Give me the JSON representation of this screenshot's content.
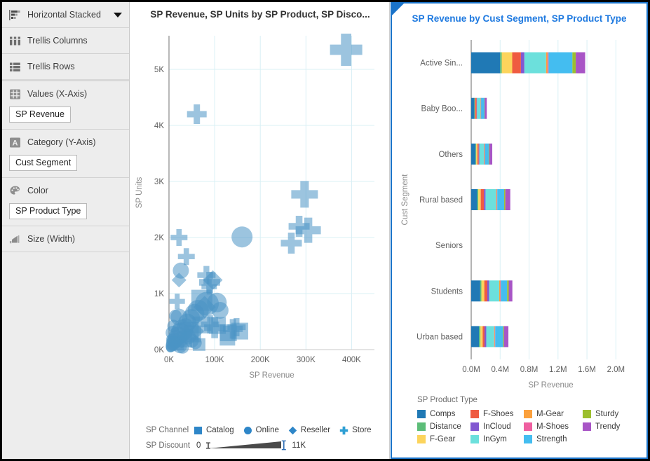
{
  "sidebar": {
    "chart_type": {
      "label": "Horizontal Stacked",
      "icon": "horizontal-stacked-icon",
      "caret": "chevron-down-icon"
    },
    "shelves": [
      {
        "label": "Trellis Columns",
        "icon": "trellis-columns-icon",
        "pill": null
      },
      {
        "label": "Trellis Rows",
        "icon": "trellis-rows-icon",
        "pill": null
      },
      {
        "label": "Values (X-Axis)",
        "icon": "values-measure-icon",
        "pill": "SP Revenue"
      },
      {
        "label": "Category (Y-Axis)",
        "icon": "attribute-icon",
        "pill": "Cust Segment"
      },
      {
        "label": "Color",
        "icon": "palette-icon",
        "pill": "SP Product Type"
      },
      {
        "label": "Size (Width)",
        "icon": "size-width-icon",
        "pill": null
      }
    ]
  },
  "scatter": {
    "title": "SP Revenue, SP Units by SP Product, SP Disco...",
    "legends": {
      "channel": {
        "label": "SP Channel",
        "items": [
          {
            "name": "Catalog",
            "shape": "square",
            "color": "#2e86c8"
          },
          {
            "name": "Online",
            "shape": "circle",
            "color": "#2e86c8"
          },
          {
            "name": "Reseller",
            "shape": "diamond",
            "color": "#2e86c8"
          },
          {
            "name": "Store",
            "shape": "plus",
            "color": "#2e9fd4"
          }
        ]
      },
      "discount": {
        "label": "SP Discount",
        "min": "0",
        "max": "11K"
      }
    }
  },
  "bars": {
    "title": "SP Revenue by Cust Segment, SP Product Type",
    "legend_title": "SP Product Type",
    "legend_order": [
      "Comps",
      "Distance",
      "F-Gear",
      "F-Shoes",
      "InCloud",
      "InGym",
      "M-Gear",
      "M-Shoes",
      "Strength",
      "Sturdy",
      "Trendy"
    ]
  },
  "colors": {
    "Comps": "#2079b5",
    "Distance": "#5cbd78",
    "F-Gear": "#fcd45c",
    "F-Shoes": "#ef5b41",
    "InCloud": "#8258d1",
    "InGym": "#6ce0dc",
    "M-Gear": "#fba03c",
    "M-Shoes": "#ef5fa0",
    "Strength": "#44bdf0",
    "Sturdy": "#9cbf2e",
    "Trendy": "#a855c6",
    "accent": "#1a73c9",
    "scatter_mark": "#4a93c4",
    "grid": "#d9f0f5"
  },
  "chart_data": [
    {
      "type": "scatter",
      "title": "SP Revenue, SP Units by SP Product, SP Disco...",
      "xlabel": "SP Revenue",
      "ylabel": "SP Units",
      "xlim": [
        0,
        450000
      ],
      "ylim": [
        0,
        5600
      ],
      "xticks": [
        "0K",
        "100K",
        "200K",
        "300K",
        "400K"
      ],
      "xtick_values": [
        0,
        100000,
        200000,
        300000,
        400000
      ],
      "yticks": [
        "0K",
        "1K",
        "2K",
        "3K",
        "4K",
        "5K"
      ],
      "ytick_values": [
        0,
        1000,
        2000,
        3000,
        4000,
        5000
      ],
      "grid": true,
      "legend_position": "bottom",
      "shape_encoding": "SP Channel",
      "size_encoding": "SP Discount",
      "points": [
        {
          "x": 388000,
          "y": 5350,
          "shape": "plus",
          "size": 46
        },
        {
          "x": 61000,
          "y": 4200,
          "shape": "plus",
          "size": 28
        },
        {
          "x": 160000,
          "y": 2010,
          "shape": "circle",
          "size": 30
        },
        {
          "x": 297000,
          "y": 2770,
          "shape": "plus",
          "size": 38
        },
        {
          "x": 285000,
          "y": 2200,
          "shape": "plus",
          "size": 30
        },
        {
          "x": 305000,
          "y": 2130,
          "shape": "plus",
          "size": 36
        },
        {
          "x": 268000,
          "y": 1900,
          "shape": "plus",
          "size": 30
        },
        {
          "x": 22000,
          "y": 2000,
          "shape": "plus",
          "size": 24
        },
        {
          "x": 38000,
          "y": 1660,
          "shape": "plus",
          "size": 24
        },
        {
          "x": 26000,
          "y": 1410,
          "shape": "circle",
          "size": 23
        },
        {
          "x": 22000,
          "y": 1240,
          "shape": "diamond",
          "size": 21
        },
        {
          "x": 82000,
          "y": 1330,
          "shape": "plus",
          "size": 26
        },
        {
          "x": 96000,
          "y": 1240,
          "shape": "diamond",
          "size": 28
        },
        {
          "x": 89000,
          "y": 1200,
          "shape": "plus",
          "size": 30
        },
        {
          "x": 88000,
          "y": 1120,
          "shape": "plus",
          "size": 22
        },
        {
          "x": 18000,
          "y": 860,
          "shape": "plus",
          "size": 22
        },
        {
          "x": 14000,
          "y": 600,
          "shape": "circle",
          "size": 18
        },
        {
          "x": 22000,
          "y": 580,
          "shape": "circle",
          "size": 24
        },
        {
          "x": 72000,
          "y": 880,
          "shape": "square",
          "size": 30
        },
        {
          "x": 83000,
          "y": 820,
          "shape": "circle",
          "size": 34
        },
        {
          "x": 78000,
          "y": 760,
          "shape": "diamond",
          "size": 32
        },
        {
          "x": 105000,
          "y": 840,
          "shape": "circle",
          "size": 28
        },
        {
          "x": 112000,
          "y": 700,
          "shape": "circle",
          "size": 24
        },
        {
          "x": 64000,
          "y": 700,
          "shape": "circle",
          "size": 30
        },
        {
          "x": 56000,
          "y": 640,
          "shape": "circle",
          "size": 28
        },
        {
          "x": 48000,
          "y": 560,
          "shape": "circle",
          "size": 26
        },
        {
          "x": 40000,
          "y": 480,
          "shape": "circle",
          "size": 26
        },
        {
          "x": 36000,
          "y": 410,
          "shape": "circle",
          "size": 24
        },
        {
          "x": 30000,
          "y": 350,
          "shape": "circle",
          "size": 30
        },
        {
          "x": 25000,
          "y": 300,
          "shape": "circle",
          "size": 28
        },
        {
          "x": 20000,
          "y": 250,
          "shape": "circle",
          "size": 26
        },
        {
          "x": 16000,
          "y": 200,
          "shape": "circle",
          "size": 24
        },
        {
          "x": 12000,
          "y": 160,
          "shape": "circle",
          "size": 22
        },
        {
          "x": 9000,
          "y": 120,
          "shape": "circle",
          "size": 20
        },
        {
          "x": 7000,
          "y": 90,
          "shape": "circle",
          "size": 18
        },
        {
          "x": 5000,
          "y": 60,
          "shape": "circle",
          "size": 16
        },
        {
          "x": 4000,
          "y": 40,
          "shape": "circle",
          "size": 14
        },
        {
          "x": 3000,
          "y": 25,
          "shape": "circle",
          "size": 12
        },
        {
          "x": 45000,
          "y": 330,
          "shape": "square",
          "size": 26
        },
        {
          "x": 52000,
          "y": 280,
          "shape": "square",
          "size": 24
        },
        {
          "x": 60000,
          "y": 330,
          "shape": "diamond",
          "size": 22
        },
        {
          "x": 70000,
          "y": 440,
          "shape": "square",
          "size": 24
        },
        {
          "x": 90000,
          "y": 450,
          "shape": "plus",
          "size": 26
        },
        {
          "x": 100000,
          "y": 390,
          "shape": "plus",
          "size": 30
        },
        {
          "x": 106000,
          "y": 430,
          "shape": "square",
          "size": 24
        },
        {
          "x": 130000,
          "y": 300,
          "shape": "square",
          "size": 24
        },
        {
          "x": 140000,
          "y": 370,
          "shape": "plus",
          "size": 28
        },
        {
          "x": 148000,
          "y": 400,
          "shape": "plus",
          "size": 26
        },
        {
          "x": 155000,
          "y": 330,
          "shape": "square",
          "size": 24
        },
        {
          "x": 128000,
          "y": 210,
          "shape": "square",
          "size": 22
        },
        {
          "x": 34000,
          "y": 180,
          "shape": "square",
          "size": 22
        },
        {
          "x": 28000,
          "y": 140,
          "shape": "diamond",
          "size": 20
        },
        {
          "x": 18000,
          "y": 110,
          "shape": "square",
          "size": 20
        },
        {
          "x": 13000,
          "y": 75,
          "shape": "diamond",
          "size": 18
        },
        {
          "x": 42000,
          "y": 230,
          "shape": "circle",
          "size": 22
        },
        {
          "x": 50000,
          "y": 160,
          "shape": "circle",
          "size": 20
        },
        {
          "x": 58000,
          "y": 120,
          "shape": "circle",
          "size": 18
        },
        {
          "x": 66000,
          "y": 90,
          "shape": "square",
          "size": 18
        },
        {
          "x": 24000,
          "y": 60,
          "shape": "circle",
          "size": 20
        },
        {
          "x": 30000,
          "y": 40,
          "shape": "circle",
          "size": 18
        },
        {
          "x": 8000,
          "y": 300,
          "shape": "circle",
          "size": 20
        },
        {
          "x": 10000,
          "y": 420,
          "shape": "circle",
          "size": 18
        },
        {
          "x": 6000,
          "y": 180,
          "shape": "circle",
          "size": 16
        }
      ]
    },
    {
      "type": "bar",
      "orientation": "horizontal",
      "stacked": true,
      "title": "SP Revenue by Cust Segment, SP Product Type",
      "xlabel": "SP Revenue",
      "ylabel": "Cust Segment",
      "xlim": [
        0,
        2200000
      ],
      "xticks": [
        "0.0M",
        "0.4M",
        "0.8M",
        "1.2M",
        "1.6M",
        "2.0M"
      ],
      "xtick_values": [
        0,
        400000,
        800000,
        1200000,
        1600000,
        2000000
      ],
      "categories": [
        "Active Sin...",
        "Baby Boo...",
        "Others",
        "Rural based",
        "Seniors",
        "Students",
        "Urban based"
      ],
      "grid": true,
      "legend_position": "bottom",
      "series": [
        {
          "name": "Comps",
          "values": [
            400000,
            44000,
            60000,
            82000,
            0,
            125000,
            108000
          ]
        },
        {
          "name": "Distance",
          "values": [
            22000,
            5000,
            10000,
            16000,
            0,
            16000,
            20000
          ]
        },
        {
          "name": "F-Gear",
          "values": [
            145000,
            6000,
            16000,
            34000,
            0,
            40000,
            30000
          ]
        },
        {
          "name": "F-Shoes",
          "values": [
            120000,
            20000,
            18000,
            44000,
            0,
            42000,
            26000
          ]
        },
        {
          "name": "InCloud",
          "values": [
            48000,
            5000,
            9000,
            22000,
            0,
            24000,
            24000
          ]
        },
        {
          "name": "InGym",
          "values": [
            300000,
            50000,
            62000,
            148000,
            0,
            140000,
            110000
          ]
        },
        {
          "name": "M-Gear",
          "values": [
            20000,
            4000,
            8000,
            8000,
            0,
            14000,
            8000
          ]
        },
        {
          "name": "M-Shoes",
          "values": [
            14000,
            3000,
            5000,
            6000,
            0,
            8000,
            6000
          ]
        },
        {
          "name": "Strength",
          "values": [
            330000,
            46000,
            54000,
            96000,
            0,
            88000,
            108000
          ]
        },
        {
          "name": "Sturdy",
          "values": [
            46000,
            4000,
            9000,
            16000,
            0,
            22000,
            12000
          ]
        },
        {
          "name": "Trendy",
          "values": [
            130000,
            28000,
            40000,
            68000,
            0,
            50000,
            62000
          ]
        }
      ]
    }
  ]
}
